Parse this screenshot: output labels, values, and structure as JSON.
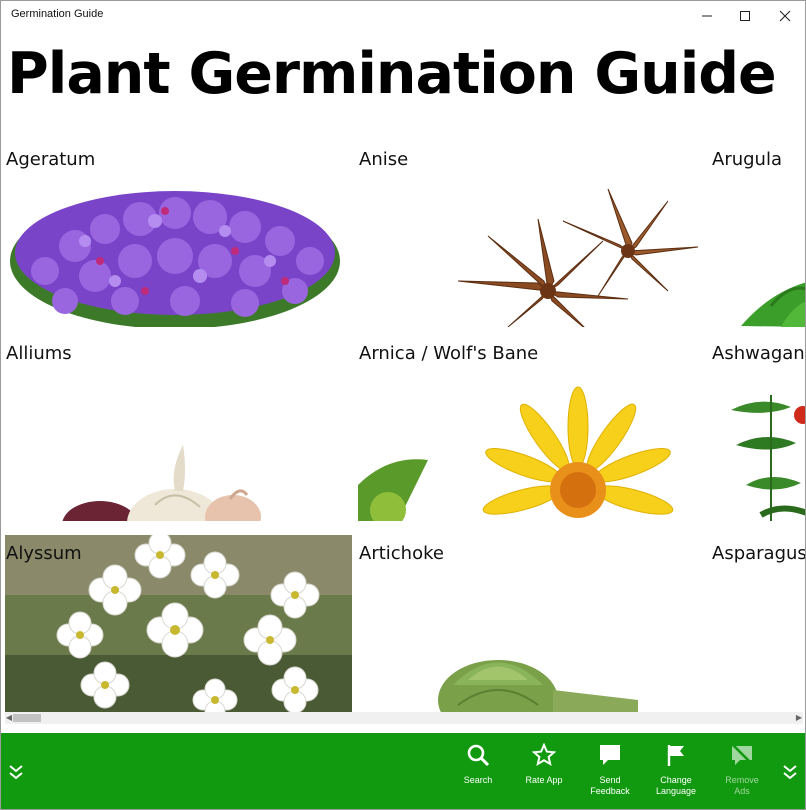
{
  "window": {
    "title": "Germination Guide",
    "controls": [
      "minimize-icon",
      "maximize-icon",
      "close-icon"
    ]
  },
  "page": {
    "title": "Plant Germination Guide"
  },
  "plants": [
    {
      "name": "Ageratum",
      "art": "purple-flower-cluster"
    },
    {
      "name": "Anise",
      "art": "star-anise"
    },
    {
      "name": "Arugula",
      "art": "green-leaves"
    },
    {
      "name": "Alliums",
      "art": "garlic-bulbs"
    },
    {
      "name": "Arnica / Wolf's Bane",
      "art": "yellow-daisy"
    },
    {
      "name": "Ashwagandha",
      "art": "red-berries-leaves"
    },
    {
      "name": "Alyssum",
      "art": "white-flowers-photo"
    },
    {
      "name": "Artichoke",
      "art": "artichoke"
    },
    {
      "name": "Asparagus",
      "art": "none"
    }
  ],
  "appbar": {
    "color": "#11990f",
    "buttons": [
      {
        "id": "search",
        "label": "Search",
        "icon": "search-icon",
        "enabled": true
      },
      {
        "id": "rate",
        "label": "Rate App",
        "icon": "star-icon",
        "enabled": true
      },
      {
        "id": "feedback",
        "label": "Send Feedback",
        "icon": "speech-bubble-icon",
        "enabled": true
      },
      {
        "id": "language",
        "label": "Change Language",
        "icon": "flag-icon",
        "enabled": true
      },
      {
        "id": "removeads",
        "label": "Remove Ads",
        "icon": "no-ads-icon",
        "enabled": false
      }
    ]
  }
}
